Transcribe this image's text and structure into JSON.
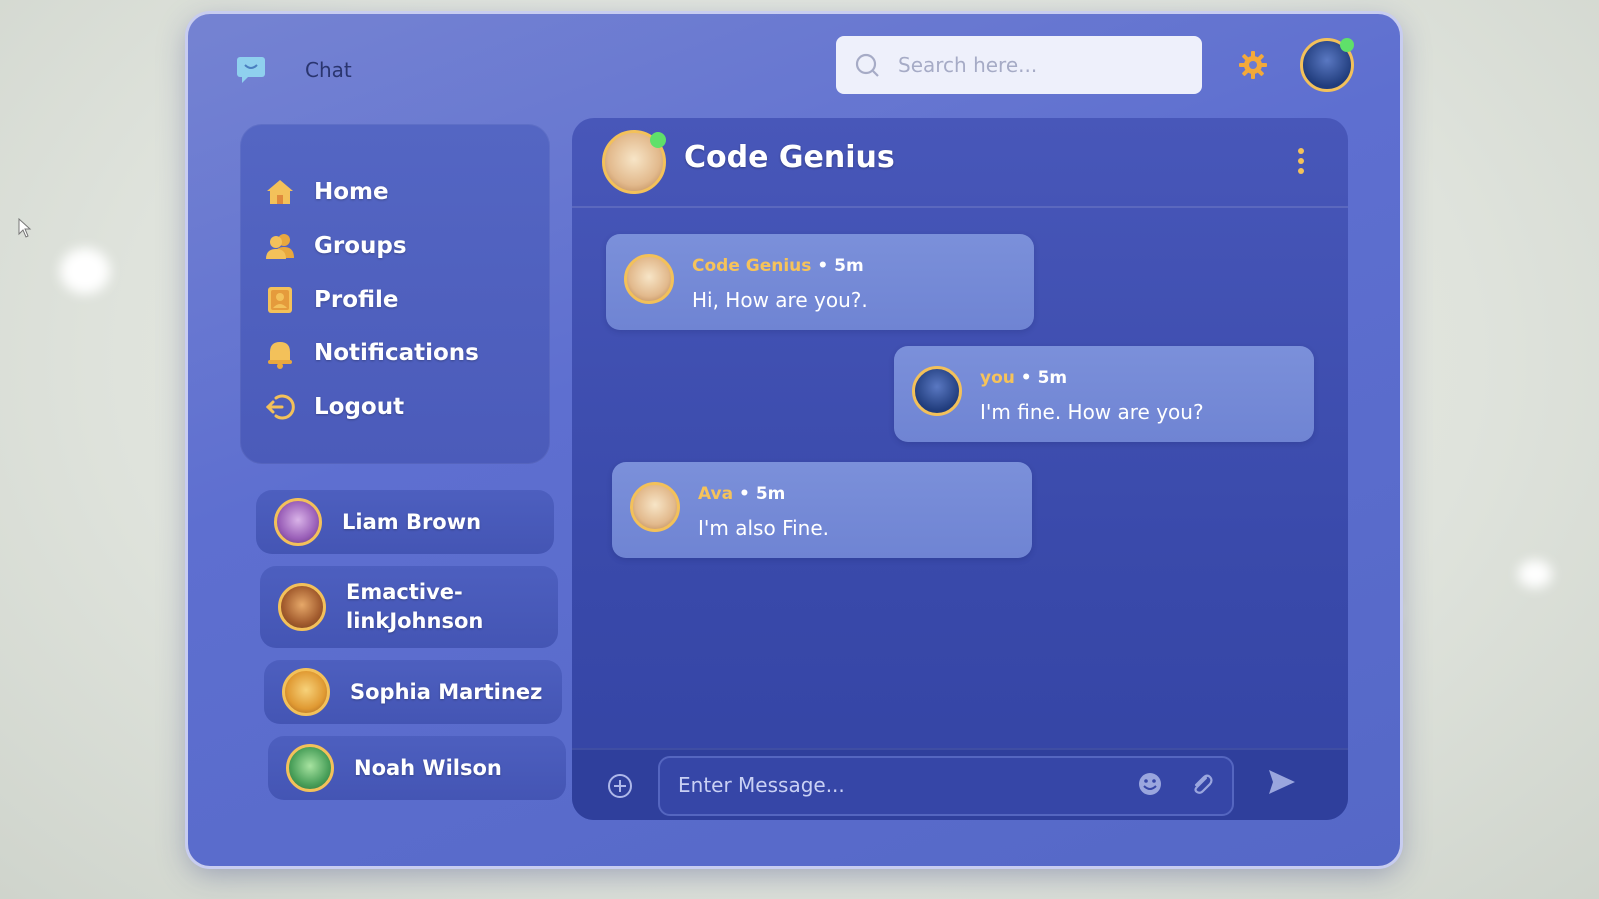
{
  "header": {
    "app_title": "Chat",
    "search_placeholder": "Search here..."
  },
  "nav": {
    "items": [
      {
        "label": "Home",
        "icon": "home-icon"
      },
      {
        "label": "Groups",
        "icon": "groups-icon"
      },
      {
        "label": "Profile",
        "icon": "profile-icon"
      },
      {
        "label": "Notifications",
        "icon": "bell-icon"
      },
      {
        "label": "Logout",
        "icon": "logout-icon"
      }
    ]
  },
  "contacts": [
    {
      "name": "Liam Brown"
    },
    {
      "name_line1": "Emactive-",
      "name_line2": "linkJohnson"
    },
    {
      "name": "Sophia Martinez"
    },
    {
      "name": "Noah Wilson"
    }
  ],
  "chat": {
    "title": "Code Genius",
    "messages": [
      {
        "sender": "Code Genius",
        "time": "5m",
        "text": "Hi, How are you?."
      },
      {
        "sender": "you",
        "time": "5m",
        "text": "I'm fine. How are you?"
      },
      {
        "sender": "Ava",
        "time": "5m",
        "text": "I'm also Fine."
      }
    ],
    "input_placeholder": "Enter Message..."
  },
  "colors": {
    "accent": "#f3c15a",
    "online": "#5fe06a",
    "frame": "#5e6fd0"
  }
}
